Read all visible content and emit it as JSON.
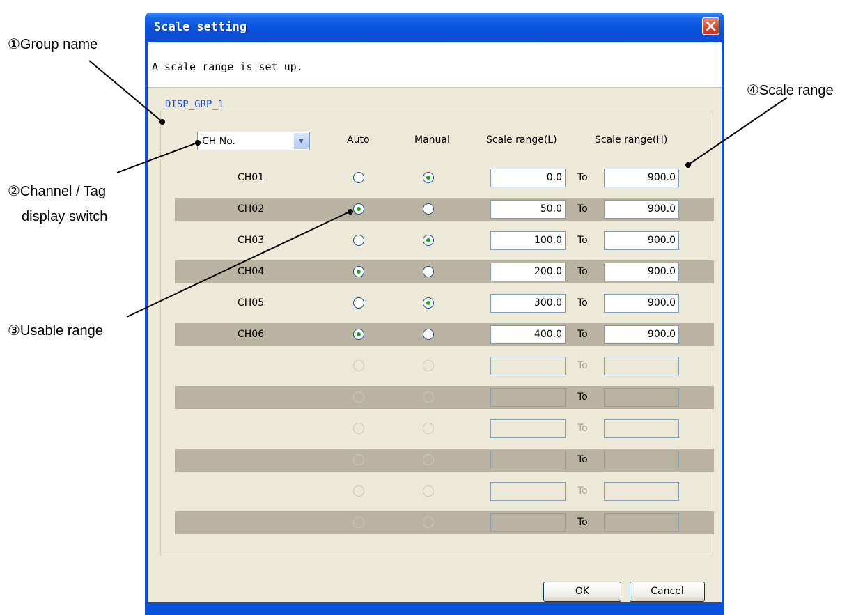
{
  "annotations": {
    "group_name": "①Group name",
    "channel_tag_line1": "②Channel / Tag",
    "channel_tag_line2": "display switch",
    "usable_range": "③Usable range",
    "scale_range": "④Scale range"
  },
  "dialog": {
    "title": "Scale setting",
    "description": "A scale range is set up.",
    "group_label": "DISP_GRP_1",
    "display_select": {
      "value": "CH No."
    },
    "headers": {
      "auto": "Auto",
      "manual": "Manual",
      "scale_low": "Scale range(L)",
      "scale_high": "Scale range(H)"
    },
    "rows": [
      {
        "channel": "CH01",
        "mode": "manual",
        "low": "0.0",
        "to": "To",
        "high": "900.0"
      },
      {
        "channel": "CH02",
        "mode": "auto",
        "low": "50.0",
        "to": "To",
        "high": "900.0"
      },
      {
        "channel": "CH03",
        "mode": "manual",
        "low": "100.0",
        "to": "To",
        "high": "900.0"
      },
      {
        "channel": "CH04",
        "mode": "auto",
        "low": "200.0",
        "to": "To",
        "high": "900.0"
      },
      {
        "channel": "CH05",
        "mode": "manual",
        "low": "300.0",
        "to": "To",
        "high": "900.0"
      },
      {
        "channel": "CH06",
        "mode": "auto",
        "low": "400.0",
        "to": "To",
        "high": "900.0"
      },
      {
        "channel": "",
        "mode": "",
        "low": "",
        "to": "To",
        "high": ""
      },
      {
        "channel": "",
        "mode": "",
        "low": "",
        "to": "To",
        "high": ""
      },
      {
        "channel": "",
        "mode": "",
        "low": "",
        "to": "To",
        "high": ""
      },
      {
        "channel": "",
        "mode": "",
        "low": "",
        "to": "To",
        "high": ""
      },
      {
        "channel": "",
        "mode": "",
        "low": "",
        "to": "To",
        "high": ""
      },
      {
        "channel": "",
        "mode": "",
        "low": "",
        "to": "To",
        "high": ""
      }
    ],
    "buttons": {
      "ok": "OK",
      "cancel": "Cancel"
    },
    "colors": {
      "title_bar": "#0a52dc",
      "body": "#ece9d8",
      "row_shade": "#b9b4a1",
      "group_label": "#1c4fd0",
      "radio_dot": "#21a121"
    }
  }
}
